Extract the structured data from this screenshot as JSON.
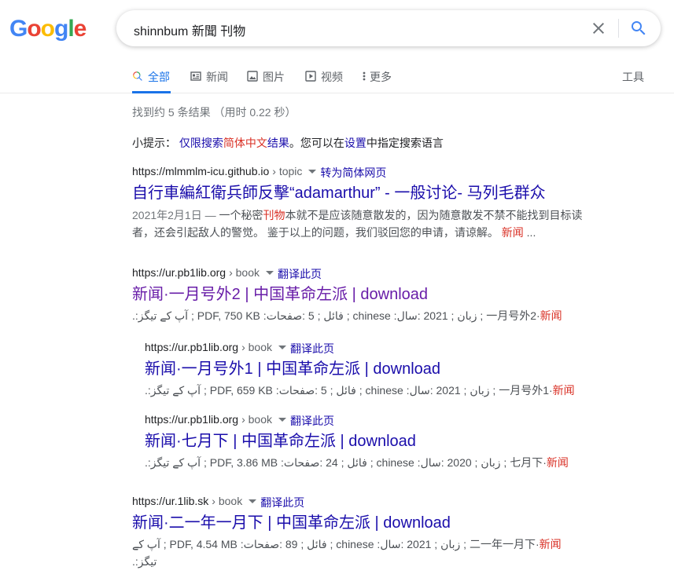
{
  "logo": {
    "letters": [
      "G",
      "o",
      "o",
      "g",
      "l",
      "e"
    ],
    "colors": [
      "#4285F4",
      "#EA4335",
      "#FBBC05",
      "#4285F4",
      "#34A853",
      "#EA4335"
    ]
  },
  "search": {
    "query": "shinnbum 新聞 刊物"
  },
  "tabs": [
    {
      "label": "全部",
      "icon": "search-icon"
    },
    {
      "label": "新闻",
      "icon": "news-icon"
    },
    {
      "label": "图片",
      "icon": "image-icon"
    },
    {
      "label": "视频",
      "icon": "video-icon"
    },
    {
      "label": "更多",
      "icon": "more-icon"
    }
  ],
  "tools_label": "工具",
  "stats": "找到约 5 条结果 （用时 0.22 秒）",
  "hint": {
    "prefix": "小提示： ",
    "link1": "仅限搜索",
    "link1_red": "简体中文",
    "link1_suffix": "结果",
    "middle": "。您可以在",
    "link2": "设置",
    "suffix": "中指定搜索语言"
  },
  "results": [
    {
      "url": "https://mlmmlm-icu.github.io",
      "crumb": "› topic",
      "translate": "转为简体网页",
      "title": "自行車編紅衛兵師反擊“adamarthur” - 一般讨论- 马列毛群众",
      "snippet_date": "2021年2月1日 — ",
      "snippet_a": "一个秘密",
      "snippet_red1": "刊物",
      "snippet_b": "本就不是应该随意散发的，因为随意散发不禁不能找到目标读者，还会引起敌人的警觉。 鉴于以上的问题，我们驳回您的申请，请谅解。 ",
      "snippet_red2": "新闻",
      "snippet_c": " ..."
    },
    {
      "url": "https://ur.pb1lib.org",
      "crumb": "› book",
      "translate": "翻译此页",
      "title": "新闻·一月号外2 | 中国革命左派 | download",
      "meta": ".:آپ کے تیگز ; PDF, 750 KB :فائل ; 5 :صفحات ; chinese :زبان ; 2021 :سال ; 一月号外2·",
      "meta_red": "新闻"
    },
    {
      "url": "https://ur.pb1lib.org",
      "crumb": "› book",
      "translate": "翻译此页",
      "title": "新闻·一月号外1 | 中国革命左派 | download",
      "meta": ".:آپ کے تیگز ; PDF, 659 KB :فائل ; 5 :صفحات ; chinese :زبان ; 2021 :سال ; 一月号外1·",
      "meta_red": "新闻"
    },
    {
      "url": "https://ur.pb1lib.org",
      "crumb": "› book",
      "translate": "翻译此页",
      "title": "新闻·七月下 | 中国革命左派 | download",
      "meta": ".:آپ کے تیگز ; PDF, 3.86 MB :فائل ; 24 :صفحات ; chinese :زبان ; 2020 :سال ; 七月下·",
      "meta_red": "新闻"
    },
    {
      "url": "https://ur.1lib.sk",
      "crumb": "› book",
      "translate": "翻译此页",
      "title": "新闻·二一年一月下 | 中国革命左派 | download",
      "meta": "آپ کے ; PDF, 4.54 MB :فائل ; 89 :صفحات ; chinese :زبان ; 2021 :سال ; 二一年一月下·",
      "meta_red": "新闻",
      "meta2": ".:تیگز"
    }
  ]
}
